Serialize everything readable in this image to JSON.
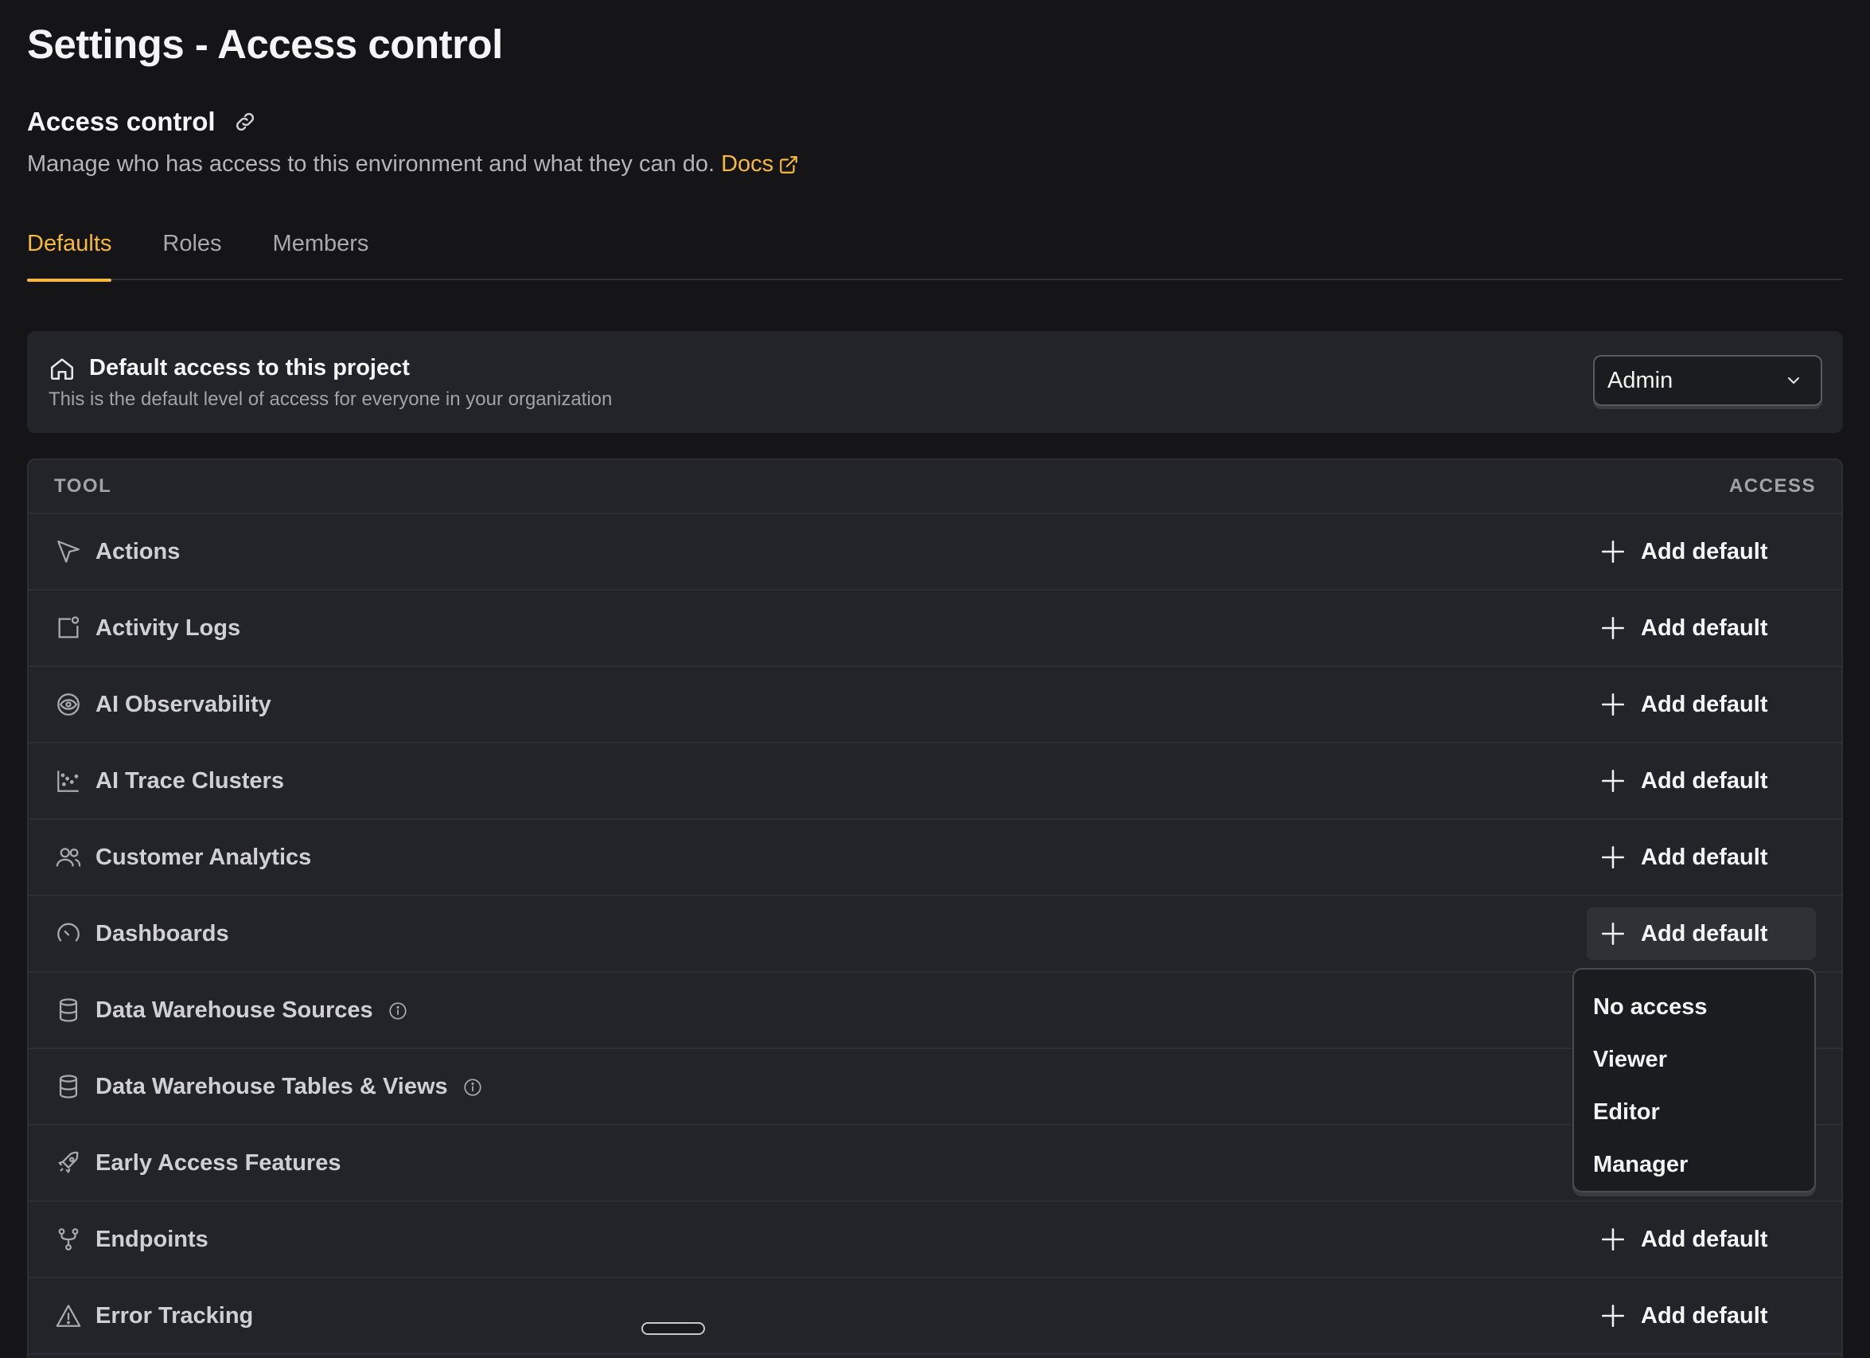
{
  "page": {
    "title": "Settings - Access control"
  },
  "section": {
    "title": "Access control",
    "description": "Manage who has access to this environment and what they can do.",
    "docs_label": "Docs"
  },
  "tabs": [
    {
      "label": "Defaults",
      "active": true
    },
    {
      "label": "Roles",
      "active": false
    },
    {
      "label": "Members",
      "active": false
    }
  ],
  "default_access": {
    "title": "Default access to this project",
    "subtitle": "This is the default level of access for everyone in your organization",
    "selected": "Admin"
  },
  "table": {
    "col_tool": "TOOL",
    "col_access": "ACCESS",
    "add_label": "Add default",
    "rows": [
      {
        "name": "Actions",
        "icon": "cursor-icon",
        "button": true
      },
      {
        "name": "Activity Logs",
        "icon": "activity-log-icon",
        "button": true
      },
      {
        "name": "AI Observability",
        "icon": "eye-icon",
        "button": true
      },
      {
        "name": "AI Trace Clusters",
        "icon": "scatter-icon",
        "button": true
      },
      {
        "name": "Customer Analytics",
        "icon": "users-icon",
        "button": true
      },
      {
        "name": "Dashboards",
        "icon": "gauge-icon",
        "button": true
      },
      {
        "name": "Data Warehouse Sources",
        "icon": "database-icon",
        "info": true,
        "button": false
      },
      {
        "name": "Data Warehouse Tables & Views",
        "icon": "database-icon",
        "info": true,
        "button": false
      },
      {
        "name": "Early Access Features",
        "icon": "rocket-icon",
        "button": false
      },
      {
        "name": "Endpoints",
        "icon": "fork-icon",
        "button": true
      },
      {
        "name": "Error Tracking",
        "icon": "warning-icon",
        "button": true
      }
    ]
  },
  "dropdown": {
    "options": [
      "No access",
      "Viewer",
      "Editor",
      "Manager"
    ]
  },
  "colors": {
    "accent": "#f6b83d",
    "background": "#151518",
    "card": "#232429"
  }
}
